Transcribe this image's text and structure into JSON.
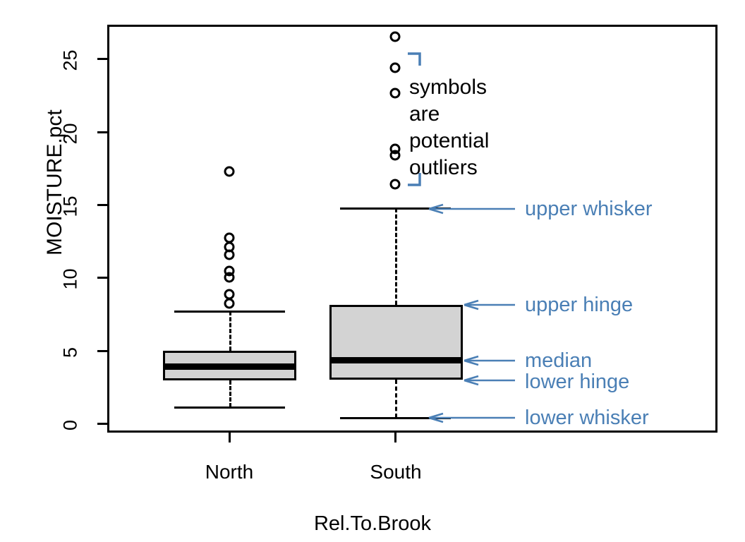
{
  "figure": {
    "y_axis_title": "MOISTURE.pct",
    "x_axis_title": "Rel.To.Brook",
    "annotation_color": "#4a7fb5",
    "box_fill_color": "#d3d3d3",
    "line_color": "#000000"
  },
  "annotations": {
    "upper_whisker": "upper whisker",
    "upper_hinge": "upper hinge",
    "median": "median",
    "lower_hinge": "lower hinge",
    "lower_whisker": "lower whisker",
    "outlier_note_lines": [
      "symbols",
      "are",
      "potential",
      "outliers"
    ]
  },
  "chart_data": {
    "type": "box",
    "title": "",
    "xlabel": "Rel.To.Brook",
    "ylabel": "MOISTURE.pct",
    "ylim": [
      -0.5,
      27.5
    ],
    "yticks": [
      0,
      5,
      10,
      15,
      20,
      25
    ],
    "ytick_labels": [
      "0",
      "5",
      "10",
      "15",
      "20",
      "25"
    ],
    "grid": false,
    "legend": "none",
    "categories": [
      "North",
      "South"
    ],
    "boxes": [
      {
        "name": "North",
        "lower_whisker": 1.1,
        "lower_hinge": 3.0,
        "median": 3.9,
        "upper_hinge": 5.1,
        "upper_whisker": 7.7,
        "outliers": [
          17.3,
          12.9,
          12.3,
          11.7,
          10.5,
          10.1,
          8.8,
          8.3
        ]
      },
      {
        "name": "South",
        "lower_whisker": 0.4,
        "lower_hinge": 3.0,
        "median": 4.4,
        "upper_hinge": 8.1,
        "upper_whisker": 14.8,
        "outliers": [
          26.3,
          24.5,
          22.5,
          18.7,
          18.4,
          16.5
        ]
      }
    ]
  }
}
